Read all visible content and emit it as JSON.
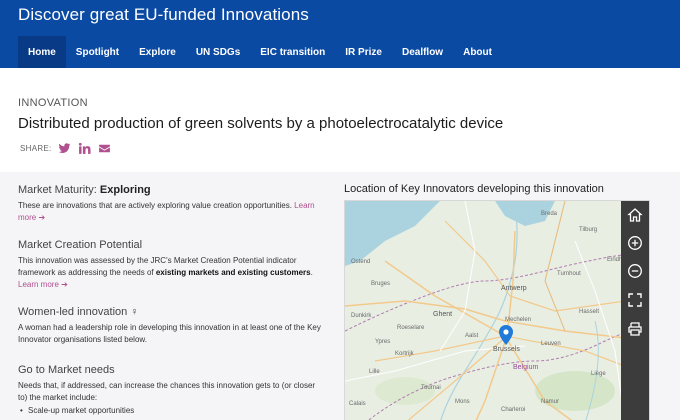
{
  "header": {
    "brand": "Discover great EU-funded Innovations",
    "nav": [
      {
        "label": "Home",
        "active": true
      },
      {
        "label": "Spotlight"
      },
      {
        "label": "Explore"
      },
      {
        "label": "UN SDGs"
      },
      {
        "label": "EIC transition"
      },
      {
        "label": "IR Prize"
      },
      {
        "label": "Dealflow"
      },
      {
        "label": "About"
      }
    ]
  },
  "innovation": {
    "eyebrow": "INNOVATION",
    "title": "Distributed production of green solvents by a photoelectrocatalytic device",
    "share_label": "SHARE:",
    "share_icons": [
      "twitter-icon",
      "linkedin-icon",
      "email-icon"
    ]
  },
  "market_maturity": {
    "label": "Market Maturity: ",
    "value": "Exploring",
    "body": "These are innovations that are actively exploring value creation opportunities.",
    "more": "Learn more"
  },
  "market_creation": {
    "label": "Market Creation Potential",
    "body_1": "This innovation was assessed by the JRC's Market Creation Potential indicator framework as addressing the needs of ",
    "body_bold": "existing markets and existing customers",
    "body_2": ". ",
    "more": "Learn more"
  },
  "women_led": {
    "label": "Women-led innovation",
    "icon": "female-icon",
    "body": "A woman had a leadership role in developing this innovation in at least one of the Key Innovator organisations listed below."
  },
  "go_to_market": {
    "label": "Go to Market needs",
    "body": "Needs that, if addressed, can increase the chances this innovation gets to (or closer to) the market include:",
    "needs": [
      "Scale-up market opportunities"
    ]
  },
  "map": {
    "title": "Location of Key Innovators developing this innovation",
    "labels": [
      "Bruges",
      "Ghent",
      "Antwerp",
      "Brussels",
      "Belgium",
      "Lille",
      "Leuven",
      "Mechelen",
      "Aalst",
      "Kortrijk",
      "Namur",
      "Charleroi",
      "Mons",
      "Hasselt",
      "Tilburg",
      "Breda",
      "Eindhoven",
      "Dunkirk",
      "Calais",
      "Ostend",
      "Liège",
      "Roeselare",
      "Ypres",
      "Tournai",
      "Turnhout"
    ],
    "controls": [
      "home-icon",
      "zoom-in-icon",
      "zoom-out-icon",
      "fullscreen-icon",
      "print-icon"
    ],
    "pin_city": "Brussels",
    "colors": {
      "land": "#e9eee3",
      "roads": "#f2c98b",
      "borders": "#b07cb0",
      "water": "#aad3df",
      "pin": "#1f7ad9"
    }
  },
  "colors": {
    "header": "#0a4aa3",
    "nav_active": "#083a86",
    "accent": "#b0508f",
    "panel_bg": "#f5f5f7"
  }
}
